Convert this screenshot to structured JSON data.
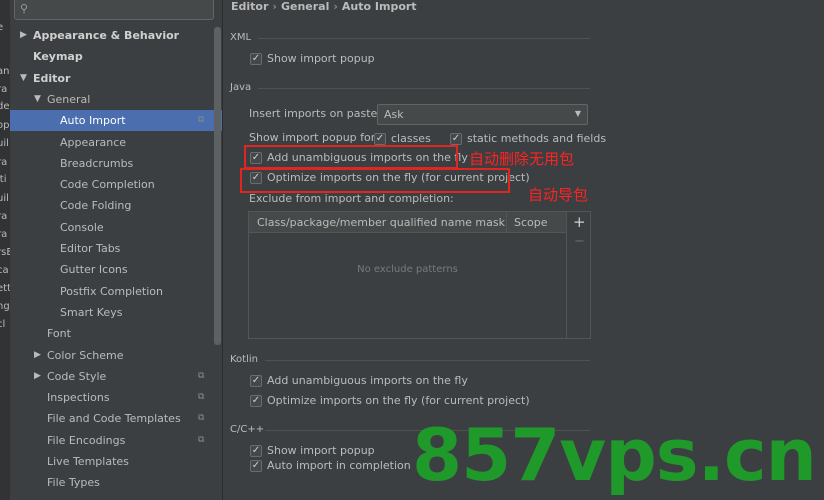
{
  "left_strip": [
    "e",
    "an",
    "ra",
    "de",
    "op",
    "uil",
    "ra",
    "iti",
    "uil",
    "ra",
    "ra",
    "rsE",
    "ca",
    "ett",
    "ng",
    "cl"
  ],
  "sidebar": {
    "search_placeholder": "",
    "items": [
      {
        "label": "Appearance & Behavior",
        "level": 0,
        "arrow": "right",
        "bold": true
      },
      {
        "label": "Keymap",
        "level": 0,
        "arrow": "",
        "bold": true
      },
      {
        "label": "Editor",
        "level": 0,
        "arrow": "down",
        "bold": true
      },
      {
        "label": "General",
        "level": 1,
        "arrow": "down"
      },
      {
        "label": "Auto Import",
        "level": 2,
        "selected": true,
        "copy": true
      },
      {
        "label": "Appearance",
        "level": 2
      },
      {
        "label": "Breadcrumbs",
        "level": 2
      },
      {
        "label": "Code Completion",
        "level": 2
      },
      {
        "label": "Code Folding",
        "level": 2
      },
      {
        "label": "Console",
        "level": 2
      },
      {
        "label": "Editor Tabs",
        "level": 2
      },
      {
        "label": "Gutter Icons",
        "level": 2
      },
      {
        "label": "Postfix Completion",
        "level": 2
      },
      {
        "label": "Smart Keys",
        "level": 2
      },
      {
        "label": "Font",
        "level": 1
      },
      {
        "label": "Color Scheme",
        "level": 1,
        "arrow": "right"
      },
      {
        "label": "Code Style",
        "level": 1,
        "arrow": "right",
        "copy": true
      },
      {
        "label": "Inspections",
        "level": 1,
        "copy": true
      },
      {
        "label": "File and Code Templates",
        "level": 1,
        "copy": true
      },
      {
        "label": "File Encodings",
        "level": 1,
        "copy": true
      },
      {
        "label": "Live Templates",
        "level": 1
      },
      {
        "label": "File Types",
        "level": 1
      }
    ]
  },
  "breadcrumb": [
    "Editor",
    "General",
    "Auto Import"
  ],
  "xml": {
    "title": "XML",
    "show_import_popup": "Show import popup"
  },
  "java": {
    "title": "Java",
    "insert_label": "Insert imports on paste:",
    "insert_value": "Ask",
    "popup_for_label": "Show import popup for:",
    "classes": "classes",
    "static_methods": "static methods and fields",
    "add_unambiguous": "Add unambiguous imports on the fly",
    "optimize_imports": "Optimize imports on the fly (for current project)",
    "exclude_label": "Exclude from import and completion:",
    "table_col1": "Class/package/member qualified name mask",
    "table_col2": "Scope",
    "table_empty": "No exclude patterns"
  },
  "annotations": {
    "remove_unused": "自动删除无用包",
    "auto_import": "自动导包"
  },
  "kotlin": {
    "title": "Kotlin",
    "add_unambiguous": "Add unambiguous imports on the fly",
    "optimize_imports": "Optimize imports on the fly (for current project)"
  },
  "cpp": {
    "title": "C/C++",
    "show_import_popup": "Show import popup",
    "auto_import_completion": "Auto import in completion"
  },
  "watermark": "857vps.cn",
  "colors": {
    "selection": "#4b6eaf",
    "annotation_red": "#ff2222",
    "watermark_green": "#1f9a2a"
  }
}
